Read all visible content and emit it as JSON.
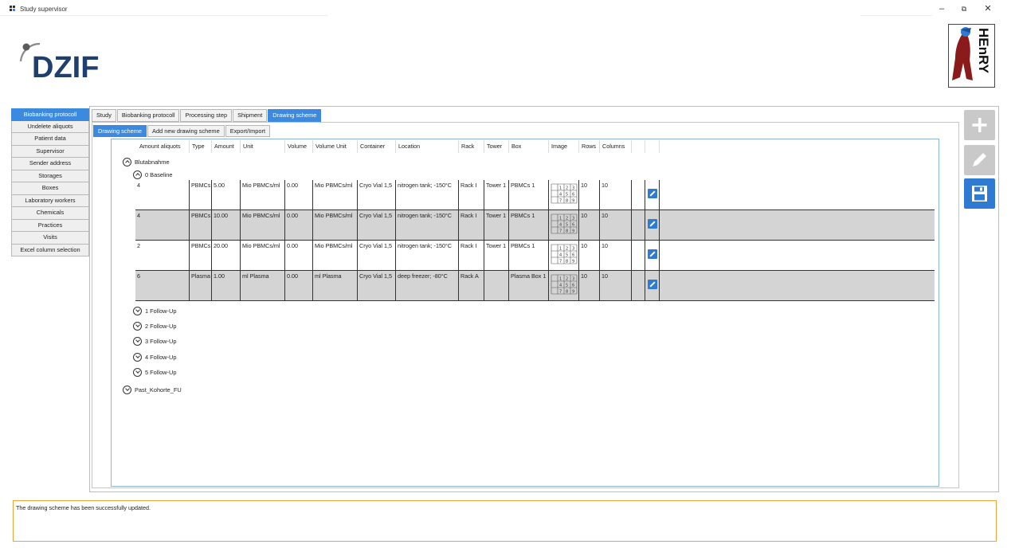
{
  "window": {
    "title": "Study supervisor",
    "minimize_glyph": "–",
    "restore_glyph": "⧉",
    "close_glyph": "✕",
    "icon": "app-grid-icon"
  },
  "logos": {
    "left": "DZIF",
    "right": "HEnRY"
  },
  "sidebar": {
    "items": [
      {
        "label": "Biobanking protocoll",
        "active": true
      },
      {
        "label": "Undelete aliquots"
      },
      {
        "label": "Patient data"
      },
      {
        "label": "Supervisor"
      },
      {
        "label": "Sender address"
      },
      {
        "label": "Storages"
      },
      {
        "label": "Boxes"
      },
      {
        "label": "Laboratory workers"
      },
      {
        "label": "Chemicals"
      },
      {
        "label": "Practices"
      },
      {
        "label": "Visits"
      },
      {
        "label": "Excel column selection"
      }
    ]
  },
  "tabs": [
    {
      "label": "Study"
    },
    {
      "label": "Biobanking protocoll"
    },
    {
      "label": "Processing step"
    },
    {
      "label": "Shipment"
    },
    {
      "label": "Drawing scheme",
      "active": true
    }
  ],
  "subtabs": [
    {
      "label": "Drawing scheme",
      "active": true
    },
    {
      "label": "Add new drawing scheme"
    },
    {
      "label": "Export/Import"
    }
  ],
  "table": {
    "columns": [
      "Amount aliquots",
      "Type",
      "Amount",
      "Unit",
      "Volume",
      "Volume Unit",
      "Container",
      "Location",
      "Rack",
      "Tower",
      "Box",
      "Image",
      "Rows",
      "Columns",
      "",
      ""
    ],
    "rows": [
      {
        "amount_aliquots": "4",
        "type": "PBMCs",
        "amount": "5.00",
        "unit": "Mio PBMCs/ml",
        "volume": "0.00",
        "volume_unit": "Mio PBMCs/ml",
        "container": "Cryo Vial 1,5",
        "location": "nitrogen tank; -150°C",
        "rack": "Rack I",
        "tower": "Tower 1",
        "box": "PBMCs 1",
        "rows": "10",
        "columns": "10"
      },
      {
        "amount_aliquots": "4",
        "type": "PBMCs",
        "amount": "10.00",
        "unit": "Mio PBMCs/ml",
        "volume": "0.00",
        "volume_unit": "Mio PBMCs/ml",
        "container": "Cryo Vial 1,5",
        "location": "nitrogen tank; -150°C",
        "rack": "Rack I",
        "tower": "Tower 1",
        "box": "PBMCs 1",
        "rows": "10",
        "columns": "10"
      },
      {
        "amount_aliquots": "2",
        "type": "PBMCs",
        "amount": "20.00",
        "unit": "Mio PBMCs/ml",
        "volume": "0.00",
        "volume_unit": "Mio PBMCs/ml",
        "container": "Cryo Vial 1,5",
        "location": "nitrogen tank; -150°C",
        "rack": "Rack I",
        "tower": "Tower 1",
        "box": "PBMCs 1",
        "rows": "10",
        "columns": "10"
      },
      {
        "amount_aliquots": "6",
        "type": "Plasma",
        "amount": "1.00",
        "unit": "ml Plasma",
        "volume": "0.00",
        "volume_unit": "ml Plasma",
        "container": "Cryo Vial 1,5",
        "location": "deep freezer; -80°C",
        "rack": "Rack A",
        "tower": "",
        "box": "Plasma Box 1",
        "rows": "10",
        "columns": "10"
      }
    ],
    "grid_digits": [
      "1",
      "2",
      "3",
      "4",
      "5",
      "6",
      "7",
      "8",
      "9"
    ]
  },
  "tree": {
    "group": "Blutabnahme",
    "baseline": "0 Baseline",
    "followups": [
      "1 Follow-Up",
      "2 Follow-Up",
      "3 Follow-Up",
      "4 Follow-Up",
      "5 Follow-Up"
    ],
    "other_group": "Past_Kohorte_FU"
  },
  "tools": {
    "add": "plus-icon",
    "edit": "pencil-icon",
    "save": "save-icon"
  },
  "status": {
    "message": "The drawing scheme has been successfully updated."
  },
  "colors": {
    "accent": "#3c8ae0",
    "status_border": "#f0a23a",
    "row_alt": "#d4d4d4"
  }
}
